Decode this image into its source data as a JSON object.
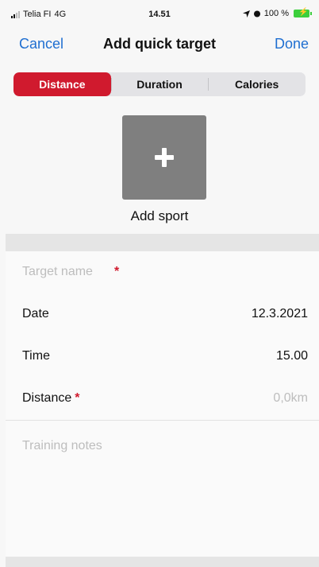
{
  "status": {
    "carrier": "Telia FI",
    "network": "4G",
    "time": "14.51",
    "battery": "100 %"
  },
  "nav": {
    "cancel_label": "Cancel",
    "title": "Add quick target",
    "done_label": "Done"
  },
  "segments": [
    "Distance",
    "Duration",
    "Calories"
  ],
  "selected_segment": "Distance",
  "add_sport": {
    "label": "Add sport",
    "icon": "plus-icon"
  },
  "form": {
    "target_name_placeholder": "Target name",
    "required_mark": "*",
    "date_label": "Date",
    "date_value": "12.3.2021",
    "time_label": "Time",
    "time_value": "15.00",
    "distance_label": "Distance",
    "distance_placeholder": "0,0km",
    "notes_placeholder": "Training notes"
  },
  "colors": {
    "accent_blue": "#1f6fd1",
    "active_red": "#d01a2e"
  }
}
